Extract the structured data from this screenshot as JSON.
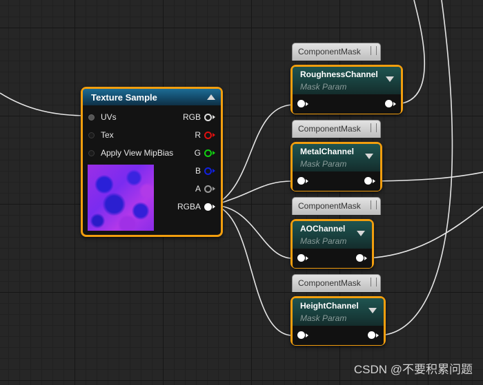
{
  "texture_sample": {
    "title": "Texture Sample",
    "inputs": [
      {
        "label": "UVs"
      },
      {
        "label": "Tex"
      },
      {
        "label": "Apply View MipBias"
      }
    ],
    "outputs": [
      {
        "label": "RGB",
        "color": "#e0e0e0"
      },
      {
        "label": "R",
        "color": "#e01010"
      },
      {
        "label": "G",
        "color": "#10d010"
      },
      {
        "label": "B",
        "color": "#1020e0"
      },
      {
        "label": "A",
        "color": "#9a9a9a"
      },
      {
        "label": "RGBA",
        "color": "#ffffff"
      }
    ]
  },
  "mask_nodes": [
    {
      "tag": "ComponentMask",
      "title": "RoughnessChannel",
      "subtitle": "Mask Param"
    },
    {
      "tag": "ComponentMask",
      "title": "MetalChannel",
      "subtitle": "Mask Param"
    },
    {
      "tag": "ComponentMask",
      "title": "AOChannel",
      "subtitle": "Mask Param"
    },
    {
      "tag": "ComponentMask",
      "title": "HeightChannel",
      "subtitle": "Mask Param"
    }
  ],
  "watermark": "CSDN @不要积累问题",
  "colors": {
    "node_border": "#f29e0e",
    "wire": "#e6e6e6",
    "grid_background": "#262626"
  }
}
